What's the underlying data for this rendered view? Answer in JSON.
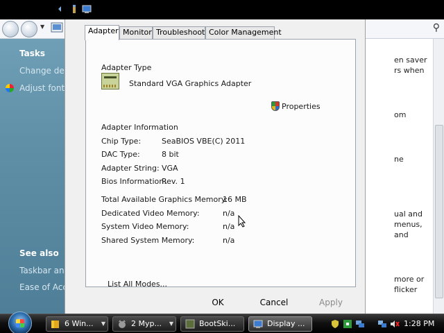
{
  "background_window": {
    "sidebar": {
      "tasks_heading": "Tasks",
      "task_links": [
        "Change de",
        "Adjust font"
      ],
      "see_also_heading": "See also",
      "see_also_links": [
        "Taskbar and",
        "Ease of Acc"
      ]
    },
    "content_fragments": [
      "en saver",
      "rs when",
      "om",
      "ne",
      "ual and",
      "menus,",
      "and",
      "more or",
      "flicker"
    ]
  },
  "dialog": {
    "tabs": [
      "Adapter",
      "Monitor",
      "Troubleshoot",
      "Color Management"
    ],
    "active_tab": "Adapter",
    "adapter_type": {
      "heading": "Adapter Type",
      "name": "Standard VGA Graphics Adapter",
      "properties_label": "Properties"
    },
    "adapter_info": {
      "heading": "Adapter Information",
      "rows": [
        {
          "label": "Chip Type:",
          "value": "SeaBIOS VBE(C) 2011"
        },
        {
          "label": "DAC Type:",
          "value": "8 bit"
        },
        {
          "label": "Adapter String:",
          "value": "VGA"
        },
        {
          "label": "Bios Information:",
          "value": "Rev. 1"
        }
      ]
    },
    "memory": [
      {
        "label": "Total Available Graphics Memory:",
        "value": "16 MB"
      },
      {
        "label": "Dedicated Video Memory:",
        "value": "n/a"
      },
      {
        "label": "System Video Memory:",
        "value": "n/a"
      },
      {
        "label": "Shared System Memory:",
        "value": "n/a"
      }
    ],
    "list_all_modes_label": "List All Modes...",
    "buttons": {
      "ok": "OK",
      "cancel": "Cancel",
      "apply": "Apply"
    }
  },
  "taskbar": {
    "buttons": [
      {
        "label": "6 Win...",
        "icon": "folder-icon"
      },
      {
        "label": "2 Myp...",
        "icon": "cat-face-icon"
      },
      {
        "label": "BootSki...",
        "icon": "app-icon"
      },
      {
        "label": "Display ...",
        "icon": "display-settings-icon",
        "active": true
      }
    ],
    "clock": "1:28 PM"
  }
}
